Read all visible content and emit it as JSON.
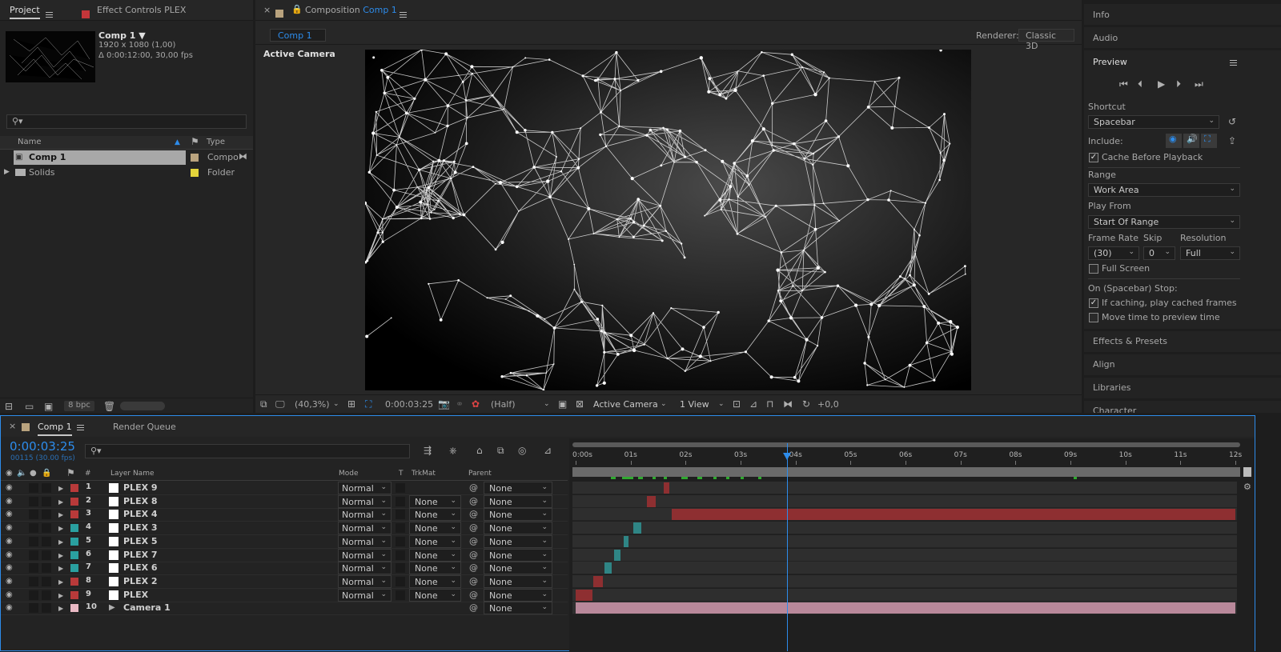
{
  "project": {
    "tab_label": "Project",
    "effect_tab_label": "Effect Controls PLEX",
    "comp_name": "Comp 1 ▼",
    "comp_size": "1920 x 1080 (1,00)",
    "comp_duration": "Δ 0:00:12:00, 30,00 fps",
    "search_placeholder": "",
    "col_name": "Name",
    "col_type": "Type",
    "items": [
      {
        "name": "Comp 1",
        "type": "Compo",
        "color": "#b9a37e"
      },
      {
        "name": "Solids",
        "type": "Folder",
        "color": "#e3d43b"
      }
    ],
    "bpc": "8 bpc"
  },
  "composition": {
    "tab_prefix": "Composition",
    "tab_comp": "Comp 1",
    "subtab": "Comp 1",
    "renderer_label": "Renderer:",
    "renderer_value": "Classic 3D",
    "camera_label": "Active Camera",
    "zoom": "(40,3%)",
    "timecode": "0:00:03:25",
    "resolution": "(Half)",
    "view_camera": "Active Camera",
    "views": "1 View",
    "exposure": "+0,0"
  },
  "right": {
    "info": "Info",
    "audio": "Audio",
    "preview": "Preview",
    "shortcut_label": "Shortcut",
    "shortcut_value": "Spacebar",
    "include_label": "Include:",
    "cache_label": "Cache Before Playback",
    "range_label": "Range",
    "range_value": "Work Area",
    "playfrom_label": "Play From",
    "playfrom_value": "Start Of Range",
    "framerate_label": "Frame Rate",
    "skip_label": "Skip",
    "resolution_label": "Resolution",
    "framerate_value": "(30)",
    "skip_value": "0",
    "resolution_value": "Full",
    "fullscreen_label": "Full Screen",
    "onstop_label": "On (Spacebar) Stop:",
    "ifcaching_label": "If caching, play cached frames",
    "movetime_label": "Move time to preview time",
    "effects": "Effects & Presets",
    "align": "Align",
    "libraries": "Libraries",
    "character": "Character"
  },
  "timeline": {
    "tab_label": "Comp 1",
    "render_queue": "Render Queue",
    "timecode": "0:00:03:25",
    "frames": "00115 (30.00 fps)",
    "col_hash": "#",
    "col_layer": "Layer Name",
    "col_mode": "Mode",
    "col_t": "T",
    "col_trkmat": "TrkMat",
    "col_parent": "Parent",
    "ticks": [
      "0:00s",
      "01s",
      "02s",
      "03s",
      "04s",
      "05s",
      "06s",
      "07s",
      "08s",
      "09s",
      "10s",
      "11s",
      "12s"
    ],
    "current_time_s": 3.85,
    "duration_s": 12,
    "layers": [
      {
        "num": "1",
        "name": "PLEX 9",
        "color": "#b83a3a",
        "mode": "Normal",
        "trkmat": "",
        "parent": "None",
        "in": 1.6,
        "out": 1.7
      },
      {
        "num": "2",
        "name": "PLEX 8",
        "color": "#b83a3a",
        "mode": "Normal",
        "trkmat": "None",
        "parent": "None",
        "in": 1.3,
        "out": 1.45
      },
      {
        "num": "3",
        "name": "PLEX 4",
        "color": "#b83a3a",
        "mode": "Normal",
        "trkmat": "None",
        "parent": "None",
        "in": 1.75,
        "out": 12
      },
      {
        "num": "4",
        "name": "PLEX 3",
        "color": "#2aa0a0",
        "mode": "Normal",
        "trkmat": "None",
        "parent": "None",
        "in": 1.05,
        "out": 1.2
      },
      {
        "num": "5",
        "name": "PLEX 5",
        "color": "#2aa0a0",
        "mode": "Normal",
        "trkmat": "None",
        "parent": "None",
        "in": 0.88,
        "out": 0.95
      },
      {
        "num": "6",
        "name": "PLEX 7",
        "color": "#2aa0a0",
        "mode": "Normal",
        "trkmat": "None",
        "parent": "None",
        "in": 0.7,
        "out": 0.82
      },
      {
        "num": "7",
        "name": "PLEX 6",
        "color": "#2aa0a0",
        "mode": "Normal",
        "trkmat": "None",
        "parent": "None",
        "in": 0.52,
        "out": 0.65
      },
      {
        "num": "8",
        "name": "PLEX 2",
        "color": "#b83a3a",
        "mode": "Normal",
        "trkmat": "None",
        "parent": "None",
        "in": 0.32,
        "out": 0.5
      },
      {
        "num": "9",
        "name": "PLEX",
        "color": "#b83a3a",
        "mode": "Normal",
        "trkmat": "None",
        "parent": "None",
        "in": 0,
        "out": 0.3
      },
      {
        "num": "10",
        "name": "Camera 1",
        "color": "#e9b9c4",
        "mode": "",
        "trkmat": "",
        "parent": "None",
        "in": 0,
        "out": 12
      }
    ]
  }
}
